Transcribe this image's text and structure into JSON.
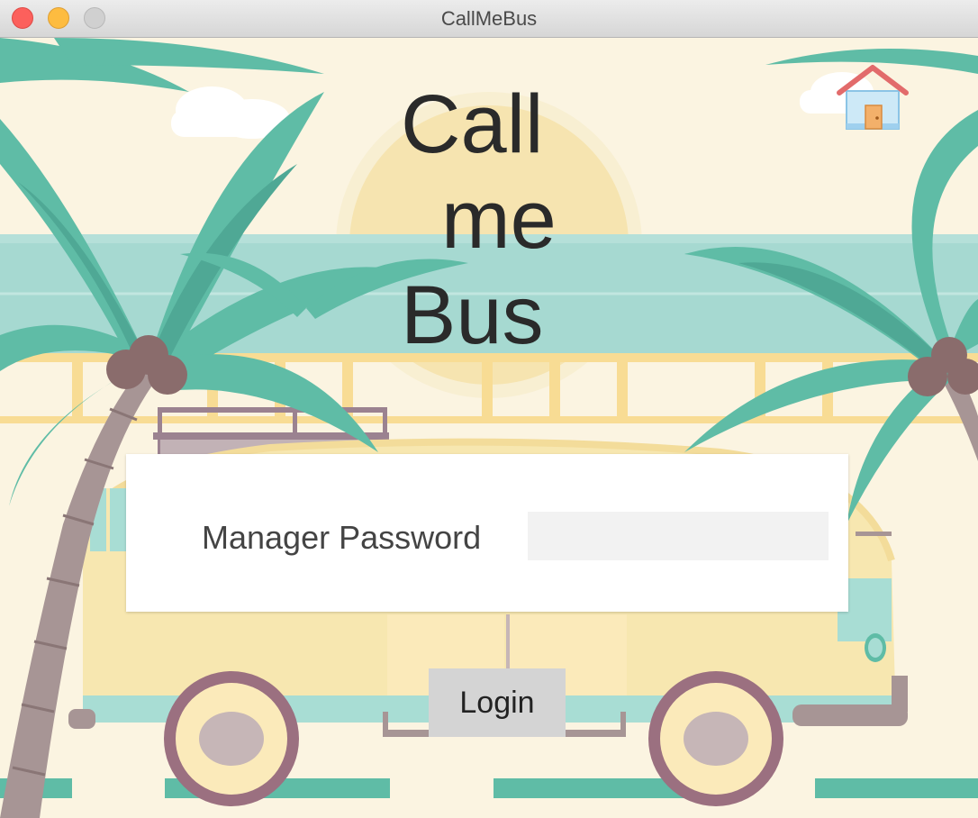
{
  "window": {
    "title": "CallMeBus"
  },
  "brand": {
    "line1": "Call",
    "line2": "me",
    "line3": "Bus"
  },
  "home": {
    "icon": "home-icon"
  },
  "login_form": {
    "password_label": "Manager Password",
    "password_value": "",
    "login_label": "Login"
  },
  "colors": {
    "background": "#f6f1e3",
    "palm_leaf": "#5fbca6",
    "sea": "#a6d9d1",
    "sun": "#f6e4b0",
    "bus_body": "#f7e7b0",
    "trunk": "#a79595",
    "login_button": "#d4d4d4"
  }
}
